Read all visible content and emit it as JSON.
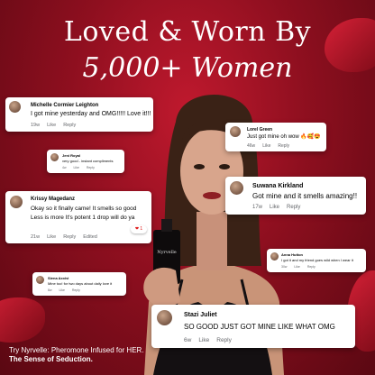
{
  "headline": {
    "line1": "Loved & Worn By",
    "line2": "5,000+ Women"
  },
  "comments": [
    {
      "name": "Michelle Cormier Leighton",
      "text": "I got mine yesterday and OMG!!!!! Love it!!!",
      "time": "19w",
      "like": "Like",
      "reply": "Reply"
    },
    {
      "name": "Lorel Green",
      "text": "Just got mine oh wow",
      "emoji": "🔥🥰😍",
      "time": "46w",
      "like": "Like",
      "reply": "Reply"
    },
    {
      "name": "Jeni Royal",
      "text": "very good - instant compliments",
      "time": "4w",
      "like": "Like",
      "reply": "Reply"
    },
    {
      "name": "Suwana Kirkland",
      "text": "Got mine and it smells amazing!!",
      "time": "17w",
      "like": "Like",
      "reply": "Reply"
    },
    {
      "name": "Krissy Magedanz",
      "text_lines": [
        "Okay so it finally came! It smells so good",
        "Less is more It's potent 1 drop will do ya"
      ],
      "time": "21w",
      "like": "Like",
      "reply": "Reply",
      "edited": "Edited",
      "reaction": "❤ 1"
    },
    {
      "name": "Anna Hutton",
      "text": "I got it and my friend goes wild when I wear it",
      "time": "30w",
      "like": "Like",
      "reply": "Reply"
    },
    {
      "name": "Siena Axxivi",
      "text": "Mine too! for two days about daily love it",
      "time": "8w",
      "like": "Like",
      "reply": "Reply"
    },
    {
      "name": "Stazi Juliet",
      "text": "SO GOOD JUST GOT MINE LIKE WHAT OMG",
      "time": "6w",
      "like": "Like",
      "reply": "Reply"
    }
  ],
  "product": {
    "label": "Nyrvelle"
  },
  "footer": {
    "line1": "Try Nyrvelle: Pheromone Infused for HER.",
    "line2": "The Sense of Seduction."
  },
  "colors": {
    "background": "#9a1224",
    "card": "#ffffff",
    "text": "#050505",
    "muted": "#65676b"
  }
}
